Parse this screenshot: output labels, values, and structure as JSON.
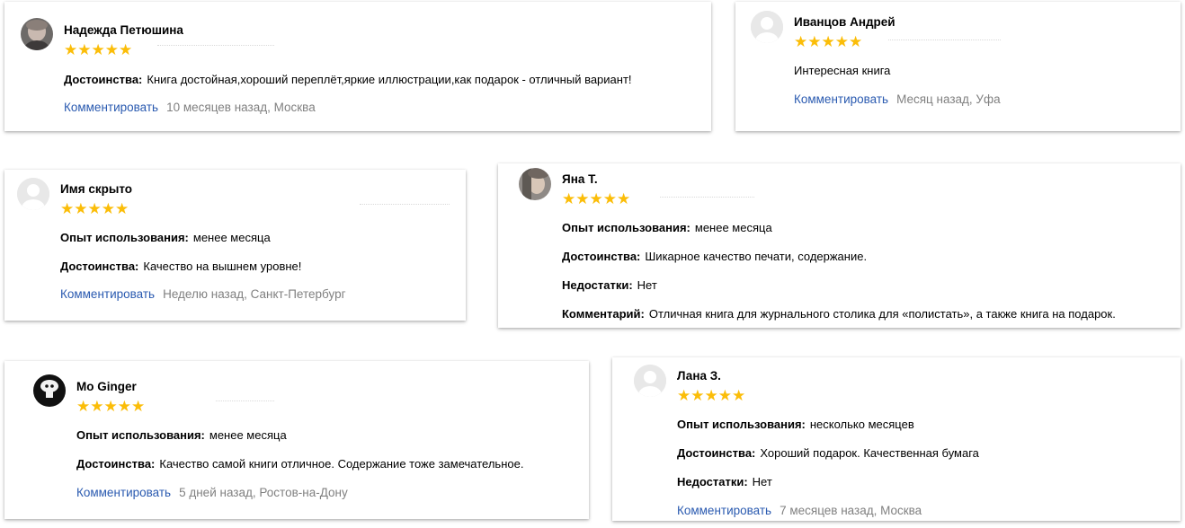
{
  "reviews": [
    {
      "name": "Надежда Петюшина",
      "stars": "★★★★★",
      "fields": [
        {
          "label": "Достоинства:",
          "value": "Книга достойная,хороший переплёт,яркие иллюстрации,как подарок - отличный вариант!"
        }
      ],
      "comment_label": "Комментировать",
      "meta": "10 месяцев назад, Москва"
    },
    {
      "name": "Иванцов Андрей",
      "stars": "★★★★★",
      "text": "Интересная книга",
      "comment_label": "Комментировать",
      "meta": "Месяц назад, Уфа"
    },
    {
      "name": "Имя скрыто",
      "stars": "★★★★★",
      "fields": [
        {
          "label": "Опыт использования:",
          "value": "менее месяца"
        },
        {
          "label": "Достоинства:",
          "value": "Качество на вышнем уровне!"
        }
      ],
      "comment_label": "Комментировать",
      "meta": "Неделю назад, Санкт-Петербург"
    },
    {
      "name": "Яна Т.",
      "stars": "★★★★★",
      "fields": [
        {
          "label": "Опыт использования:",
          "value": "менее месяца"
        },
        {
          "label": "Достоинства:",
          "value": "Шикарное качество печати, содержание."
        },
        {
          "label": "Недостатки:",
          "value": "Нет"
        },
        {
          "label": "Комментарий:",
          "value": "Отличная книга для журнального столика для «полистать», а также книга на подарок."
        }
      ]
    },
    {
      "name": "Mo Ginger",
      "stars": "★★★★★",
      "fields": [
        {
          "label": "Опыт использования:",
          "value": "менее месяца"
        },
        {
          "label": "Достоинства:",
          "value": "Качество самой книги отличное. Содержание тоже замечательное."
        }
      ],
      "comment_label": "Комментировать",
      "meta": "5 дней назад, Ростов-на-Дону"
    },
    {
      "name": "Лана З.",
      "stars": "★★★★★",
      "fields": [
        {
          "label": "Опыт использования:",
          "value": "несколько месяцев"
        },
        {
          "label": "Достоинства:",
          "value": "Хороший подарок. Качественная бумага"
        },
        {
          "label": "Недостатки:",
          "value": "Нет"
        }
      ],
      "comment_label": "Комментировать",
      "meta": "7 месяцев назад, Москва"
    }
  ]
}
